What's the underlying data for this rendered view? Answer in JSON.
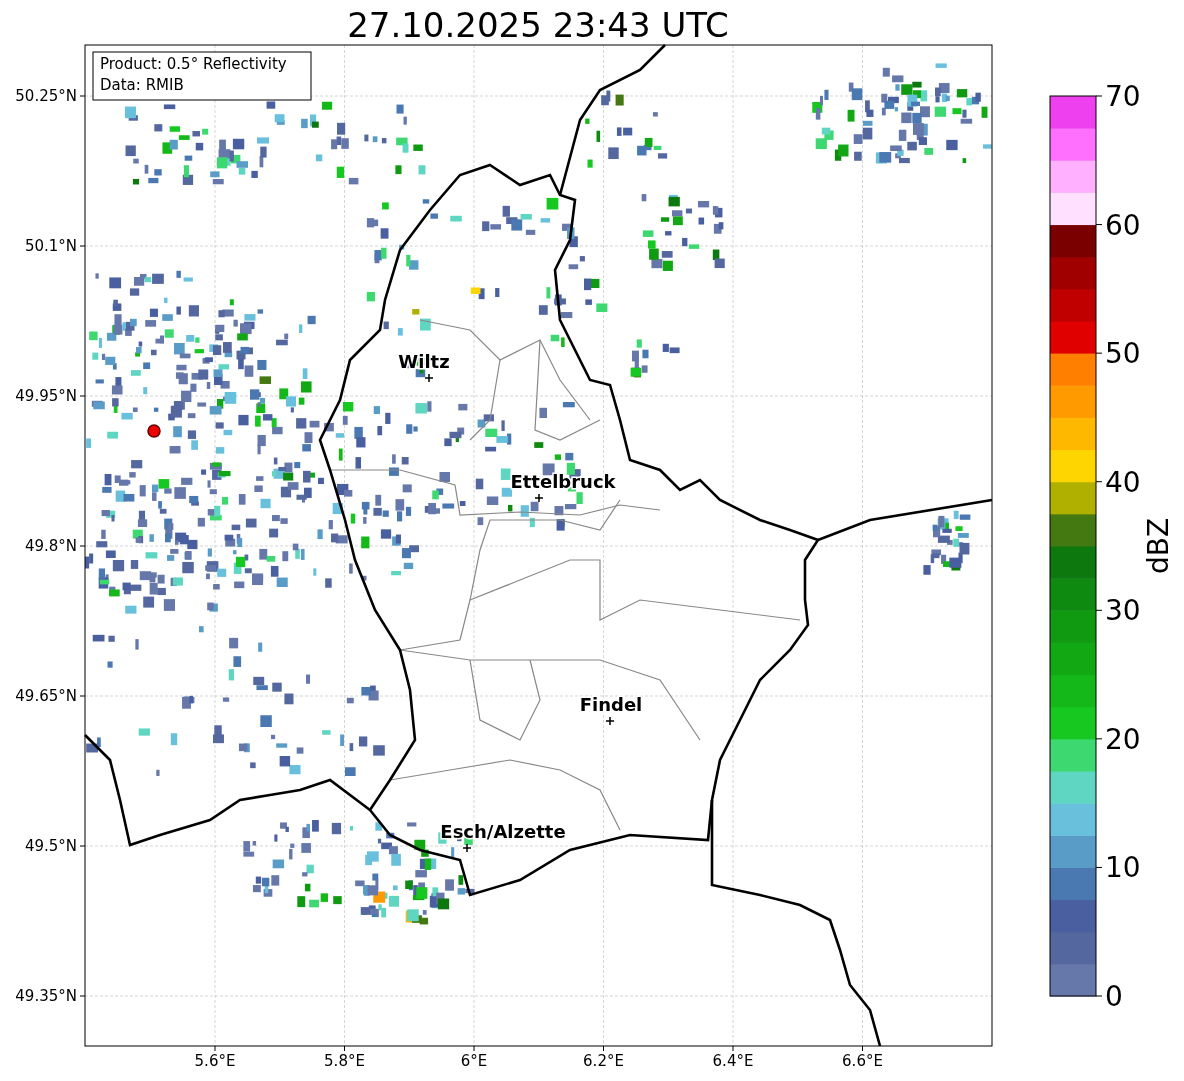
{
  "title": "27.10.2025 23:43 UTC",
  "info_box": {
    "lines": [
      "Product: 0.5° Reflectivity",
      "Data: RMIB"
    ]
  },
  "map": {
    "x_ticks": [
      "5.6°E",
      "5.8°E",
      "6°E",
      "6.2°E",
      "6.4°E",
      "6.6°E"
    ],
    "y_ticks": [
      "50.25°N",
      "50.1°N",
      "49.95°N",
      "49.8°N",
      "49.65°N",
      "49.5°N",
      "49.35°N"
    ],
    "cities": [
      {
        "name": "Wiltz"
      },
      {
        "name": "Ettelbruck"
      },
      {
        "name": "Findel"
      },
      {
        "name": "Esch/Alzette"
      }
    ]
  },
  "colorbar": {
    "label": "dBZ",
    "ticks": [
      "70",
      "60",
      "50",
      "40",
      "30",
      "20",
      "10",
      "0"
    ]
  }
}
